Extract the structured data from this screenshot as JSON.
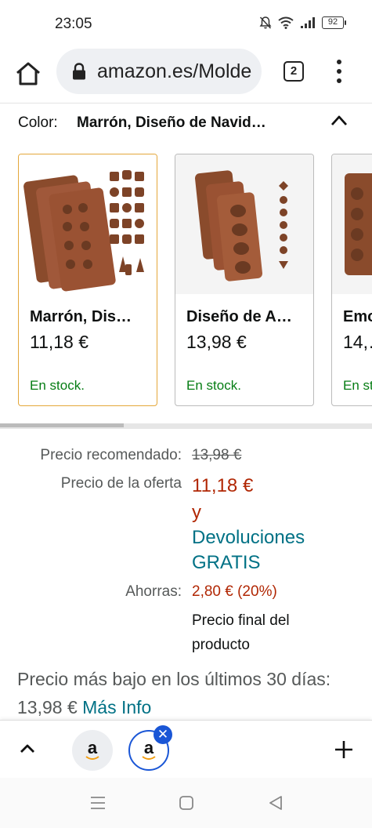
{
  "status_bar": {
    "time": "23:05",
    "battery": "92"
  },
  "browser": {
    "url": "amazon.es/Molde",
    "tab_count": "2"
  },
  "color_selector": {
    "label": "Color:",
    "value": "Marrón, Diseño de Navid…"
  },
  "variants": [
    {
      "name": "Marrón, Dis…",
      "price": "11,18 €",
      "stock": "En stock.",
      "selected": true
    },
    {
      "name": "Diseño de A…",
      "price": "13,98 €",
      "stock": "En stock.",
      "selected": false
    },
    {
      "name": "Emo…",
      "price": "14,…",
      "stock": "En st…",
      "selected": false
    }
  ],
  "pricing": {
    "list_label": "Precio recomendado:",
    "list_price": "13,98 €",
    "offer_label": "Precio de la oferta",
    "offer_price": "11,18 €",
    "offer_and": "y",
    "free_returns": "Devoluciones GRATIS",
    "savings_label": "Ahorras:",
    "savings_value": "2,80 € (20%)",
    "final_note": "Precio final del producto"
  },
  "lowest_price": {
    "text": "Precio más bajo en los últimos 30 días: 13,98 €",
    "link": "Más Info"
  },
  "tab_strip": {
    "tab1_letter": "a",
    "tab2_letter": "a",
    "close_symbol": "✕"
  },
  "colors": {
    "accent_link": "#007185",
    "price_red": "#b12704",
    "stock_green": "#067d14",
    "selected_border": "#e4a73a",
    "tab_active": "#1a56d6"
  }
}
